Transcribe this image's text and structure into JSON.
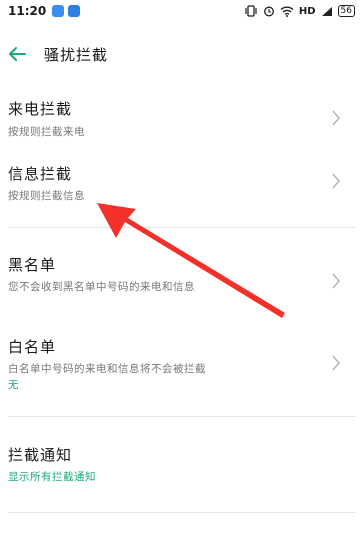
{
  "status": {
    "time": "11:20",
    "hd": "HD",
    "battery": "56"
  },
  "colors": {
    "accent": "#1aa97a",
    "arrow": "#f2312a"
  },
  "header": {
    "title": "骚扰拦截"
  },
  "rows": [
    {
      "title": "来电拦截",
      "subtitle": "按规则拦截来电"
    },
    {
      "title": "信息拦截",
      "subtitle": "按规则拦截信息"
    },
    {
      "title": "黑名单",
      "subtitle": "您不会收到黑名单中号码的来电和信息"
    },
    {
      "title": "白名单",
      "subtitle": "白名单中号码的来电和信息将不会被拦截",
      "subtitle2": "无"
    },
    {
      "title": "拦截通知",
      "subtitle": "显示所有拦截通知"
    }
  ]
}
